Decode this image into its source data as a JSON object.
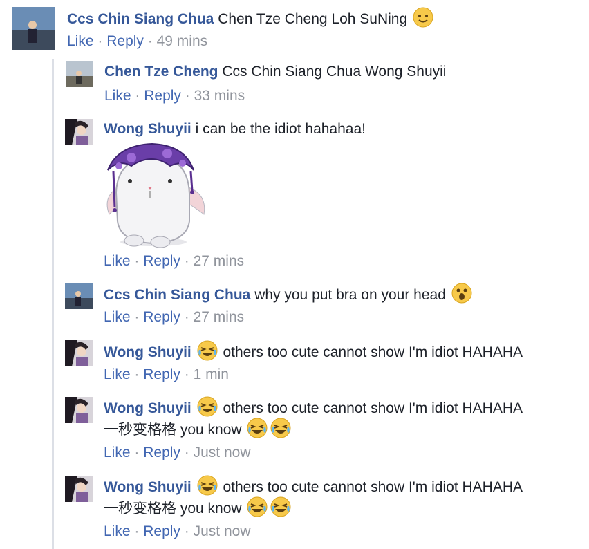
{
  "comments": [
    {
      "author": "Ccs Chin Siang Chua",
      "text": "Chen Tze Cheng Loh SuNing",
      "like": "Like",
      "reply": "Reply",
      "time": "49 mins"
    },
    {
      "author": "Chen Tze Cheng",
      "text": "Ccs Chin Siang Chua Wong Shuyii",
      "like": "Like",
      "reply": "Reply",
      "time": "33 mins"
    },
    {
      "author": "Wong Shuyii",
      "text": "i can be the idiot hahahaa!",
      "like": "Like",
      "reply": "Reply",
      "time": "27 mins"
    },
    {
      "author": "Ccs Chin Siang Chua",
      "text": "why you put bra on your head",
      "like": "Like",
      "reply": "Reply",
      "time": "27 mins"
    },
    {
      "author": "Wong Shuyii",
      "text": "others too cute cannot show I'm idiot HAHAHA",
      "like": "Like",
      "reply": "Reply",
      "time": "1 min"
    },
    {
      "author": "Wong Shuyii",
      "text": "others too cute cannot show I'm idiot HAHAHA",
      "text2": "一秒变格格 you know",
      "like": "Like",
      "reply": "Reply",
      "time": "Just now"
    },
    {
      "author": "Wong Shuyii",
      "text": "others too cute cannot show I'm idiot HAHAHA",
      "text2": "一秒变格格 you know",
      "like": "Like",
      "reply": "Reply",
      "time": "Just now"
    }
  ],
  "separator": "·",
  "icons": {
    "smile": "smile-emoji-icon",
    "wow": "wow-emoji-icon",
    "laugh": "laughing-tears-emoji-icon",
    "sticker": "bunny-sticker-icon"
  },
  "colors": {
    "author": "#365899",
    "link": "#4267b2",
    "meta": "#90949c",
    "thread_line": "#dcdfe6"
  }
}
